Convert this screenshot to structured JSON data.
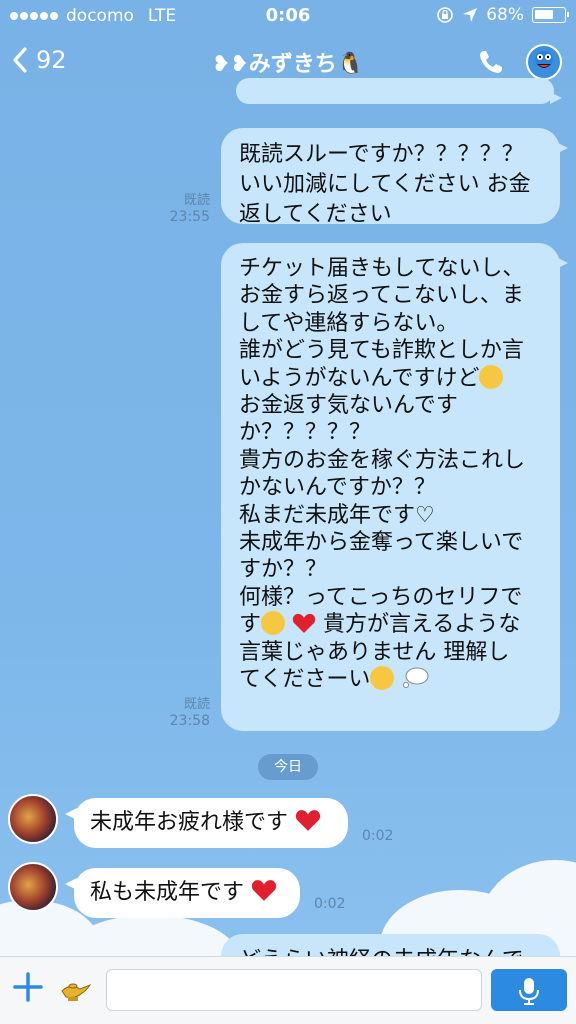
{
  "status_bar": {
    "carrier": "docomo",
    "network": "LTE",
    "time": "0:06",
    "battery": "68%",
    "battery_level": 0.68
  },
  "nav": {
    "back_count": "92",
    "title": "❥❥みずきち🐧",
    "page_count": 3,
    "active_page": 0
  },
  "messages": {
    "m1": {
      "lines": [
        "既読スルーですか？？？？？",
        "いい加減にしてください お金",
        "返してください"
      ],
      "read": "既読",
      "time": "23:55"
    },
    "m2": {
      "lines": [
        "チケット届きもしてないし、",
        "お金すら返ってこないし、ま",
        "してや連絡すらない。",
        "誰がどう見ても詐欺としか言",
        "いようがないんですけど",
        "お金返す気ないんです",
        "か？？？？？",
        "貴方のお金を稼ぐ方法これし",
        "かないんですか？？",
        "私まだ未成年です♡",
        "未成年から金奪って楽しいで",
        "すか？？",
        "何様？ってこっちのセリフで",
        "す",
        " 貴方が言えるような",
        "言葉じゃありません 理解し",
        "てくださーい"
      ],
      "read": "既読",
      "time": "23:58"
    },
    "date_label": "今日",
    "r1": {
      "text": "未成年お疲れ様です",
      "time": "0:02"
    },
    "r2": {
      "text": "私も未成年です",
      "time": "0:02"
    },
    "m3": {
      "text": "どえらい神経の未成年なんで"
    }
  },
  "input": {
    "placeholder": ""
  },
  "colors": {
    "background": "#7ab4e6",
    "outgoing_bubble": "#c8e6fb",
    "incoming_bubble": "#ffffff",
    "accent": "#2c8be0",
    "heart": "#e0202e"
  },
  "icons": [
    "back-chevron-icon",
    "phone-icon",
    "genie-icon",
    "plus-icon",
    "lamp-icon",
    "microphone-icon",
    "location-arrow-icon",
    "rotation-lock-icon"
  ]
}
